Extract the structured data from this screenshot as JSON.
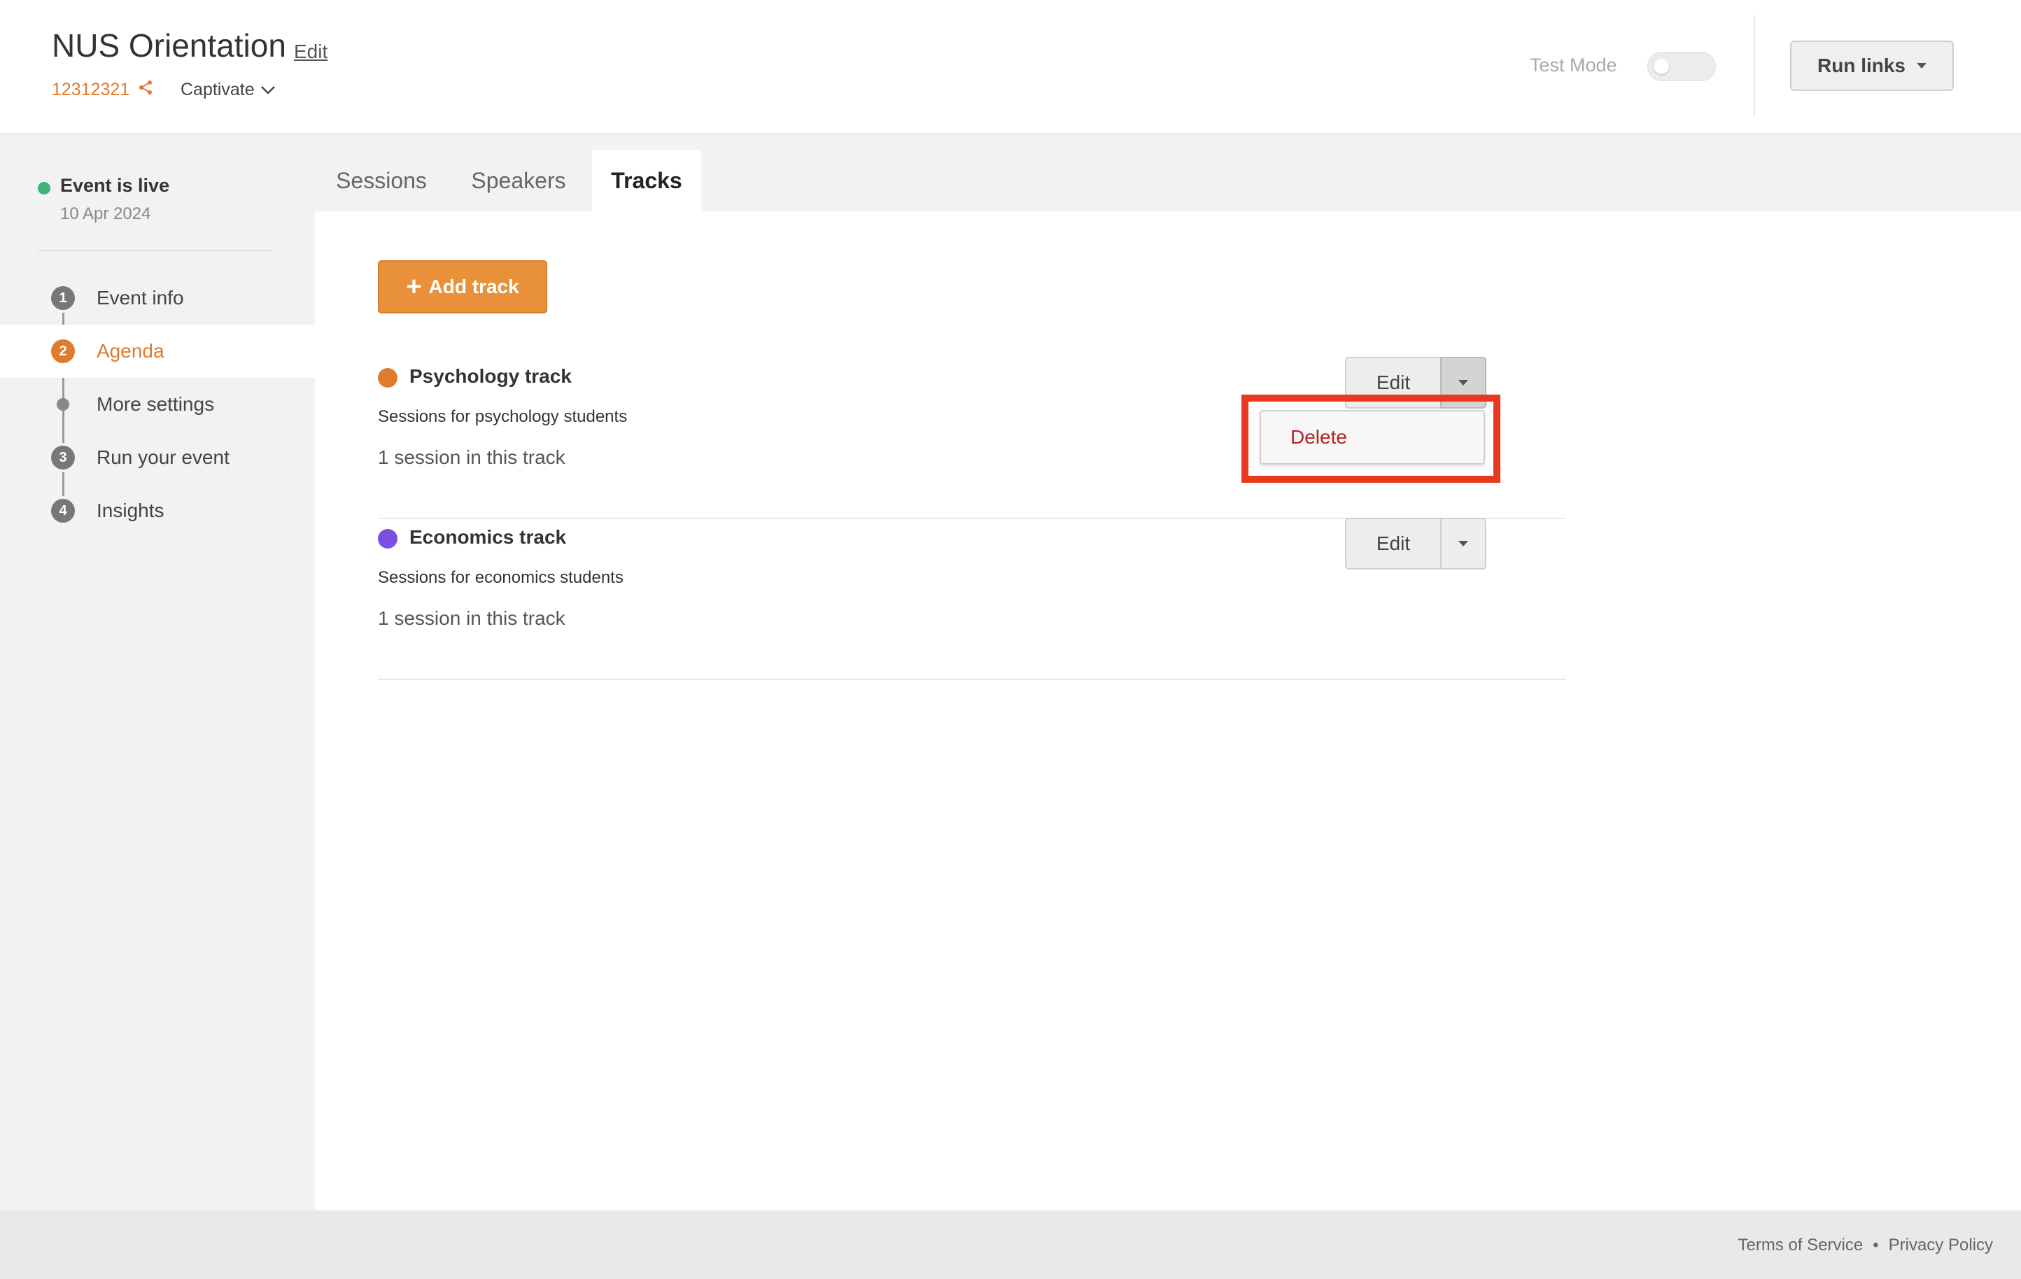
{
  "header": {
    "event_title": "NUS Orientation",
    "edit_label": "Edit",
    "event_code": "12312321",
    "org_name": "Captivate",
    "test_mode_label": "Test Mode",
    "run_links_label": "Run links"
  },
  "sidebar": {
    "status_text": "Event is live",
    "status_date": "10 Apr 2024",
    "items": [
      {
        "step": "1",
        "label": "Event info"
      },
      {
        "step": "2",
        "label": "Agenda"
      },
      {
        "step": "",
        "label": "More settings"
      },
      {
        "step": "3",
        "label": "Run your event"
      },
      {
        "step": "4",
        "label": "Insights"
      }
    ]
  },
  "tabs": [
    {
      "label": "Sessions"
    },
    {
      "label": "Speakers"
    },
    {
      "label": "Tracks"
    }
  ],
  "main": {
    "add_track_label": "Add track",
    "tracks": [
      {
        "name": "Psychology track",
        "description": "Sessions for psychology students",
        "count": "1 session in this track",
        "color": "#e07b2e",
        "edit_label": "Edit"
      },
      {
        "name": "Economics track",
        "description": "Sessions for economics students",
        "count": "1 session in this track",
        "color": "#7b4fe0",
        "edit_label": "Edit"
      }
    ],
    "dropdown": {
      "delete_label": "Delete"
    }
  },
  "footer": {
    "terms_label": "Terms of Service",
    "separator": "•",
    "privacy_label": "Privacy Policy"
  },
  "colors": {
    "accent": "#e07b2e",
    "add_button": "#e8913a",
    "live": "#3db37a",
    "danger": "#b42323",
    "highlight": "#e8381f"
  }
}
